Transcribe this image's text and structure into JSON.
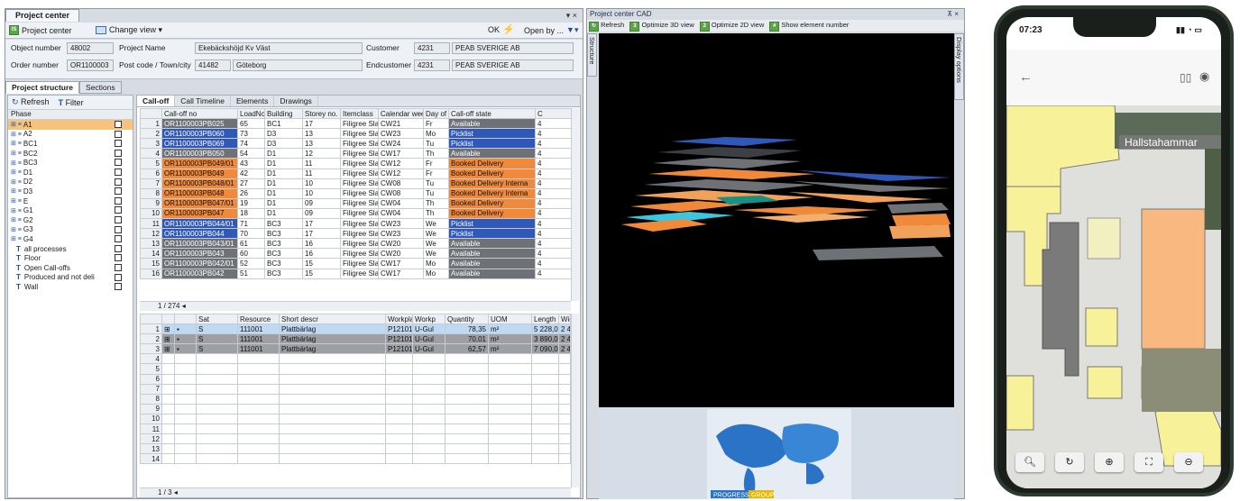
{
  "project_center": {
    "title": "Project center",
    "window_controls": "▾ ×",
    "toolbar": {
      "project_center_btn": "Project center",
      "change_view_btn": "Change view ▾",
      "ok_label": "OK",
      "open_by_label": "Open by ..."
    },
    "header": {
      "object_number_label": "Object number",
      "object_number": "48002",
      "order_number_label": "Order number",
      "order_number": "OR1100003",
      "project_name_label": "Project Name",
      "project_name": "Ekebäckshöjd Kv Väst",
      "post_code_label": "Post code / Town/city",
      "post_code": "41482",
      "town": "Göteborg",
      "customer_label": "Customer",
      "customer_id": "4231",
      "customer_name": "PEAB SVERIGE AB",
      "endcustomer_label": "Endcustomer",
      "endcustomer_id": "4231",
      "endcustomer_name": "PEAB SVERIGE AB"
    },
    "sub_tabs": [
      "Project structure",
      "Sections"
    ],
    "phase_panel": {
      "refresh": "Refresh",
      "filter": "Filter",
      "column": "Phase",
      "phases": [
        "A1",
        "A2",
        "BC1",
        "BC2",
        "BC3",
        "D1",
        "D2",
        "D3",
        "E",
        "G1",
        "G2",
        "G3",
        "G4"
      ],
      "filters": [
        "all processes",
        "Floor",
        "Open Call-offs",
        "Produced and not deli",
        "Wall"
      ]
    },
    "grid_tabs": [
      "Call-off",
      "Call Timeline",
      "Elements",
      "Drawings"
    ],
    "calloff": {
      "columns": [
        "Call-off no",
        "LoadNo",
        "Building",
        "Storey no.",
        "Itemclass",
        "Calendar week",
        "Day of",
        "Call-off state",
        "C"
      ],
      "rows": [
        {
          "n": "1",
          "no": "OR1100003PB025",
          "load": "65",
          "bld": "BC1",
          "st": "17",
          "ic": "Filigree Sla",
          "wk": "CW21",
          "day": "Fr",
          "state": "Available",
          "c": "4"
        },
        {
          "n": "2",
          "no": "OR1100003PB060",
          "load": "73",
          "bld": "D3",
          "st": "13",
          "ic": "Filigree Sla",
          "wk": "CW23",
          "day": "Mo",
          "state": "Picklist",
          "c": "4"
        },
        {
          "n": "3",
          "no": "OR1100003PB069",
          "load": "74",
          "bld": "D3",
          "st": "13",
          "ic": "Filigree Sla",
          "wk": "CW24",
          "day": "Tu",
          "state": "Picklist",
          "c": "4"
        },
        {
          "n": "4",
          "no": "OR1100003PB050",
          "load": "54",
          "bld": "D1",
          "st": "12",
          "ic": "Filigree Sla",
          "wk": "CW17",
          "day": "Th",
          "state": "Available",
          "c": "4"
        },
        {
          "n": "5",
          "no": "OR1100003PB049/01",
          "load": "43",
          "bld": "D1",
          "st": "11",
          "ic": "Filigree Sla",
          "wk": "CW12",
          "day": "Fr",
          "state": "Booked Delivery",
          "c": "4"
        },
        {
          "n": "6",
          "no": "OR1100003PB049",
          "load": "42",
          "bld": "D1",
          "st": "11",
          "ic": "Filigree Sla",
          "wk": "CW12",
          "day": "Fr",
          "state": "Booked Delivery",
          "c": "4"
        },
        {
          "n": "7",
          "no": "OR1100003PB048/01",
          "load": "27",
          "bld": "D1",
          "st": "10",
          "ic": "Filigree Sla",
          "wk": "CW08",
          "day": "Tu",
          "state": "Booked Delivery Interna",
          "c": "4"
        },
        {
          "n": "8",
          "no": "OR1100003PB048",
          "load": "26",
          "bld": "D1",
          "st": "10",
          "ic": "Filigree Sla",
          "wk": "CW08",
          "day": "Tu",
          "state": "Booked Delivery Interna",
          "c": "4"
        },
        {
          "n": "9",
          "no": "OR1100003PB047/01",
          "load": "19",
          "bld": "D1",
          "st": "09",
          "ic": "Filigree Sla",
          "wk": "CW04",
          "day": "Th",
          "state": "Booked Delivery",
          "c": "4"
        },
        {
          "n": "10",
          "no": "OR1100003PB047",
          "load": "18",
          "bld": "D1",
          "st": "09",
          "ic": "Filigree Sla",
          "wk": "CW04",
          "day": "Th",
          "state": "Booked Delivery",
          "c": "4"
        },
        {
          "n": "11",
          "no": "OR1100003PB044/01",
          "load": "71",
          "bld": "BC3",
          "st": "17",
          "ic": "Filigree Sla",
          "wk": "CW23",
          "day": "We",
          "state": "Picklist",
          "c": "4"
        },
        {
          "n": "12",
          "no": "OR1100003PB044",
          "load": "70",
          "bld": "BC3",
          "st": "17",
          "ic": "Filigree Sla",
          "wk": "CW23",
          "day": "We",
          "state": "Picklist",
          "c": "4"
        },
        {
          "n": "13",
          "no": "OR1100003PB043/01",
          "load": "61",
          "bld": "BC3",
          "st": "16",
          "ic": "Filigree Sla",
          "wk": "CW20",
          "day": "We",
          "state": "Available",
          "c": "4"
        },
        {
          "n": "14",
          "no": "OR1100003PB043",
          "load": "60",
          "bld": "BC3",
          "st": "16",
          "ic": "Filigree Sla",
          "wk": "CW20",
          "day": "We",
          "state": "Available",
          "c": "4"
        },
        {
          "n": "15",
          "no": "OR1100003PB042/01",
          "load": "52",
          "bld": "BC3",
          "st": "15",
          "ic": "Filigree Sla",
          "wk": "CW17",
          "day": "Mo",
          "state": "Available",
          "c": "4"
        },
        {
          "n": "16",
          "no": "OR1100003PB042",
          "load": "51",
          "bld": "BC3",
          "st": "15",
          "ic": "Filigree Sla",
          "wk": "CW17",
          "day": "Mo",
          "state": "Available",
          "c": "4"
        }
      ],
      "pager": "1 / 274"
    },
    "elements": {
      "columns": [
        "Sat",
        "Resource",
        "Short descr",
        "Workplace",
        "Workp",
        "Quantity",
        "UOM",
        "Length",
        "Width"
      ],
      "rows": [
        {
          "n": "1",
          "s": "S",
          "res": "111001",
          "desc": "Plattbärlag",
          "wp": "P121018",
          "wpg": "U-Gul",
          "qty": "78,35",
          "uom": "m²",
          "len": "5 228,00",
          "w": "2 40"
        },
        {
          "n": "2",
          "s": "S",
          "res": "111001",
          "desc": "Plattbärlag",
          "wp": "P121018",
          "wpg": "U-Gul",
          "qty": "70,01",
          "uom": "m²",
          "len": "3 890,00",
          "w": "2 40"
        },
        {
          "n": "3",
          "s": "S",
          "res": "111001",
          "desc": "Plattbärlag",
          "wp": "P121018",
          "wpg": "U-Gul",
          "qty": "62,57",
          "uom": "m²",
          "len": "7 090,00",
          "w": "2 40"
        }
      ],
      "empty_rows": [
        "4",
        "5",
        "6",
        "7",
        "8",
        "9",
        "10",
        "11",
        "12",
        "13",
        "14"
      ],
      "pager": "1 / 3"
    }
  },
  "cad": {
    "title": "Project center CAD",
    "controls": "⊼ ×",
    "toolbar": [
      "Refresh",
      "Optimize 3D view",
      "Optimize 2D view",
      "Show element number"
    ],
    "left_tab": "Structure",
    "right_tab": "Display options",
    "logo_text_1": "PROGRESS",
    "logo_text_2": "GROUP"
  },
  "phone": {
    "time": "07:23",
    "map_label": "Hallstahammar",
    "map_buttons": [
      "search-icon",
      "refresh-icon",
      "zoom-in-icon",
      "fit-icon",
      "zoom-out-icon"
    ]
  },
  "colors": {
    "available": "#6e7276",
    "picklist": "#2f58b8",
    "booked_delivery": "#f08a3a",
    "map_yellow": "#f7f29a",
    "map_orange": "#f9b880",
    "map_gray": "#7a7a7a"
  }
}
